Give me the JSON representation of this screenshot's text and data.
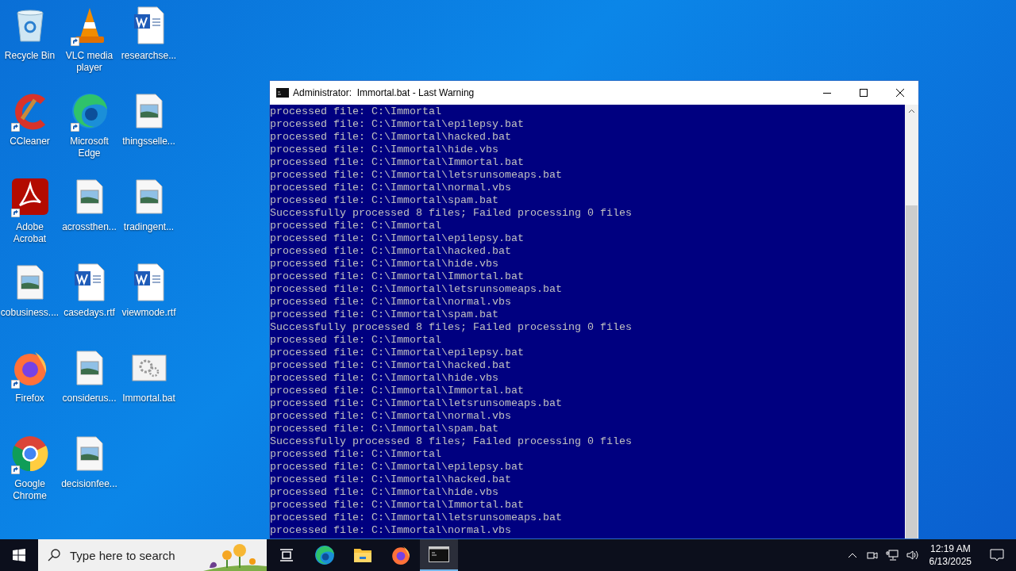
{
  "desktop_icons": [
    {
      "label": "Recycle Bin",
      "kind": "recycle",
      "shortcut": false
    },
    {
      "label": "CCleaner",
      "kind": "ccleaner",
      "shortcut": true
    },
    {
      "label": "Adobe Acrobat",
      "kind": "acrobat",
      "shortcut": true
    },
    {
      "label": "cobusiness....",
      "kind": "image",
      "shortcut": false
    },
    {
      "label": "Firefox",
      "kind": "firefox",
      "shortcut": true
    },
    {
      "label": "Google Chrome",
      "kind": "chrome",
      "shortcut": true
    },
    {
      "label": "VLC media player",
      "kind": "vlc",
      "shortcut": true
    },
    {
      "label": "Microsoft Edge",
      "kind": "edge",
      "shortcut": true
    },
    {
      "label": "acrossthen...",
      "kind": "image",
      "shortcut": false
    },
    {
      "label": "casedays.rtf",
      "kind": "word",
      "shortcut": false
    },
    {
      "label": "considerus...",
      "kind": "image",
      "shortcut": false
    },
    {
      "label": "decisionfee...",
      "kind": "image",
      "shortcut": false
    },
    {
      "label": "researchse...",
      "kind": "word",
      "shortcut": false
    },
    {
      "label": "thingsselle...",
      "kind": "image",
      "shortcut": false
    },
    {
      "label": "tradingent...",
      "kind": "image",
      "shortcut": false
    },
    {
      "label": "viewmode.rtf",
      "kind": "word",
      "shortcut": false
    },
    {
      "label": "Immortal.bat",
      "kind": "bat",
      "shortcut": false
    }
  ],
  "window": {
    "title": "Administrator:  Immortal.bat - Last Warning",
    "lines": [
      "processed file: C:\\Immortal",
      "processed file: C:\\Immortal\\epilepsy.bat",
      "processed file: C:\\Immortal\\hacked.bat",
      "processed file: C:\\Immortal\\hide.vbs",
      "processed file: C:\\Immortal\\Immortal.bat",
      "processed file: C:\\Immortal\\letsrunsomeaps.bat",
      "processed file: C:\\Immortal\\normal.vbs",
      "processed file: C:\\Immortal\\spam.bat",
      "Successfully processed 8 files; Failed processing 0 files",
      "processed file: C:\\Immortal",
      "processed file: C:\\Immortal\\epilepsy.bat",
      "processed file: C:\\Immortal\\hacked.bat",
      "processed file: C:\\Immortal\\hide.vbs",
      "processed file: C:\\Immortal\\Immortal.bat",
      "processed file: C:\\Immortal\\letsrunsomeaps.bat",
      "processed file: C:\\Immortal\\normal.vbs",
      "processed file: C:\\Immortal\\spam.bat",
      "Successfully processed 8 files; Failed processing 0 files",
      "processed file: C:\\Immortal",
      "processed file: C:\\Immortal\\epilepsy.bat",
      "processed file: C:\\Immortal\\hacked.bat",
      "processed file: C:\\Immortal\\hide.vbs",
      "processed file: C:\\Immortal\\Immortal.bat",
      "processed file: C:\\Immortal\\letsrunsomeaps.bat",
      "processed file: C:\\Immortal\\normal.vbs",
      "processed file: C:\\Immortal\\spam.bat",
      "Successfully processed 8 files; Failed processing 0 files",
      "processed file: C:\\Immortal",
      "processed file: C:\\Immortal\\epilepsy.bat",
      "processed file: C:\\Immortal\\hacked.bat",
      "processed file: C:\\Immortal\\hide.vbs",
      "processed file: C:\\Immortal\\Immortal.bat",
      "processed file: C:\\Immortal\\letsrunsomeaps.bat",
      "processed file: C:\\Immortal\\normal.vbs"
    ]
  },
  "taskbar": {
    "search": {
      "placeholder": "Type here to search"
    },
    "apps": [
      {
        "kind": "taskview",
        "active": false
      },
      {
        "kind": "edge",
        "active": false
      },
      {
        "kind": "explorer",
        "active": false
      },
      {
        "kind": "firefox",
        "active": false
      },
      {
        "kind": "console",
        "active": true
      }
    ],
    "time": "12:19 AM",
    "date": "6/13/2025"
  }
}
